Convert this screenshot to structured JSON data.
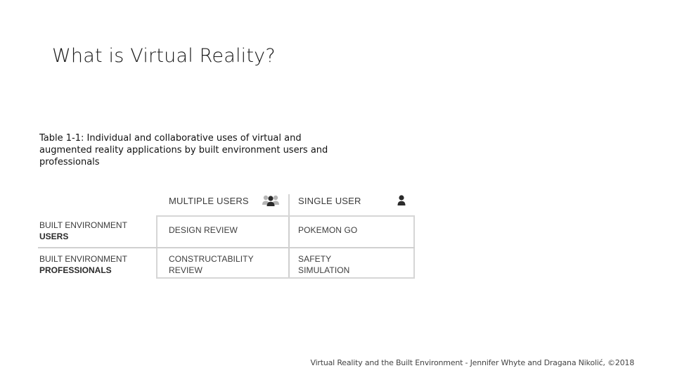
{
  "slide": {
    "title": "What is Virtual Reality?",
    "caption_lines": [
      "Table 1-1: Individual and collaborative uses of virtual and",
      "augmented reality applications by built environment users and",
      "professionals"
    ]
  },
  "table": {
    "columns": [
      "MULTIPLE USERS",
      "SINGLE USER"
    ],
    "column_icons": [
      "multiple-users-icon",
      "single-user-icon"
    ],
    "rows": [
      {
        "label_line1": "BUILT ENVIRONMENT",
        "label_line2": "USERS",
        "cells": [
          {
            "line1": "DESIGN REVIEW",
            "line2": ""
          },
          {
            "line1": "POKEMON GO",
            "line2": ""
          }
        ]
      },
      {
        "label_line1": "BUILT ENVIRONMENT",
        "label_line2": "PROFESSIONALS",
        "cells": [
          {
            "line1": "CONSTRUCTABILITY",
            "line2": "REVIEW"
          },
          {
            "line1": "SAFETY",
            "line2": "SIMULATION"
          }
        ]
      }
    ]
  },
  "footer": {
    "text": "Virtual Reality and the Built Environment - Jennifer Whyte and Dragana Nikolić, ©2018"
  },
  "colors": {
    "grid_lines": "#d0d0d0",
    "text": "#3a3a3a",
    "icon": "#2b2b2b",
    "icon_secondary": "#b0b0b0"
  }
}
